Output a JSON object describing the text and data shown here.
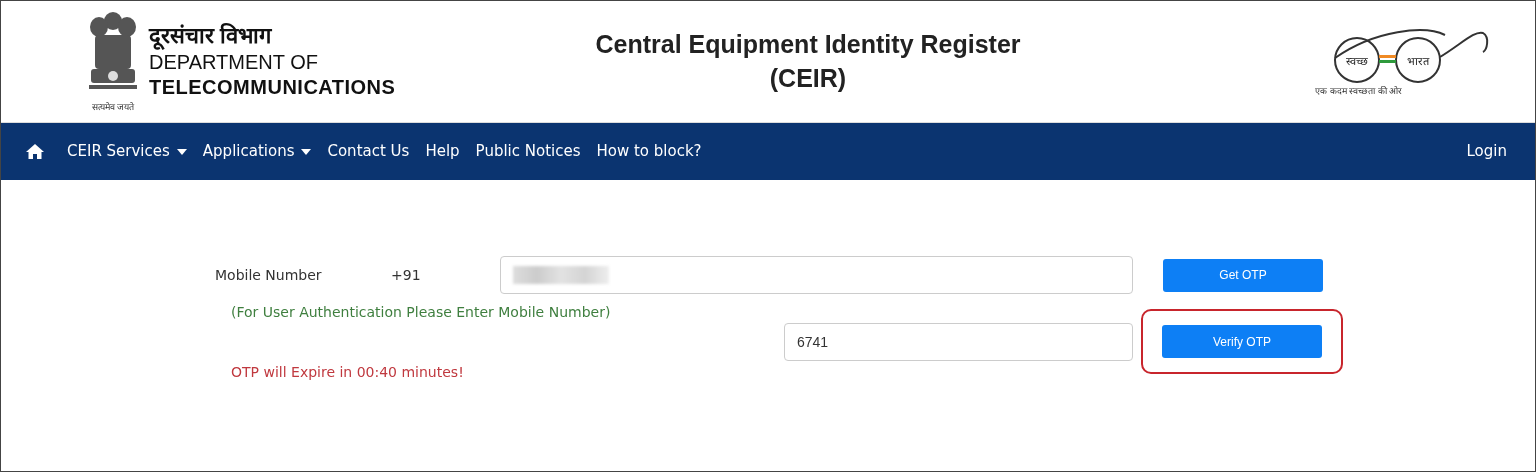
{
  "header": {
    "dept_hindi": "दूरसंचार विभाग",
    "dept_line1": "DEPARTMENT OF",
    "dept_line2": "TELECOMMUNICATIONS",
    "motto": "सत्यमेव जयते",
    "title_line1": "Central Equipment Identity Register",
    "title_line2": "(CEIR)",
    "swachh_left": "स्वच्छ",
    "swachh_right": "भारत",
    "swachh_tagline": "एक कदम स्वच्छता की ओर"
  },
  "navbar": {
    "items": [
      {
        "label": "CEIR Services",
        "dropdown": true
      },
      {
        "label": "Applications",
        "dropdown": true
      },
      {
        "label": "Contact Us",
        "dropdown": false
      },
      {
        "label": "Help",
        "dropdown": false
      },
      {
        "label": "Public Notices",
        "dropdown": false
      },
      {
        "label": "How to block?",
        "dropdown": false
      }
    ],
    "login": "Login"
  },
  "form": {
    "mobile_label": "Mobile Number",
    "country_code": "+91",
    "mobile_value_redacted": true,
    "get_otp": "Get OTP",
    "hint": "(For User Authentication Please Enter Mobile Number)",
    "otp_value": "6741",
    "verify_otp": "Verify OTP",
    "verify_highlighted": true,
    "expiry": "OTP will Expire in 00:40 minutes!"
  }
}
